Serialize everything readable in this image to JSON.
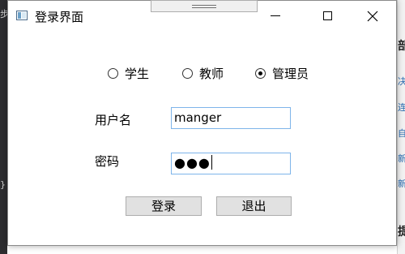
{
  "background": {
    "editor_glyphs": [
      "步",
      "}"
    ],
    "right_panel_glyphs": [
      "部",
      "决",
      "连",
      "自",
      "新",
      "新",
      "提"
    ]
  },
  "window": {
    "title": "登录界面"
  },
  "roles": {
    "options": [
      "学生",
      "教师",
      "管理员"
    ],
    "selected": "管理员"
  },
  "form": {
    "username_label": "用户名",
    "username_value": "manger",
    "password_label": "密码",
    "password_masked": "●●●"
  },
  "buttons": {
    "login": "登录",
    "exit": "退出"
  }
}
